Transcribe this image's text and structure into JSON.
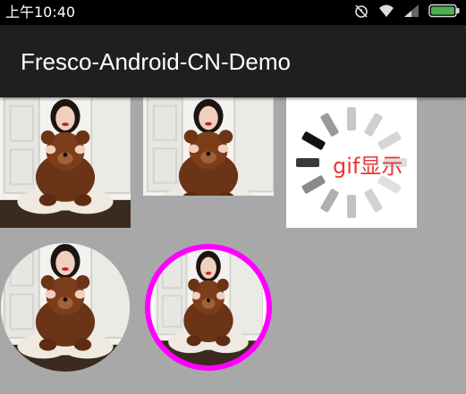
{
  "status_bar": {
    "time": "上午10:40",
    "icons": [
      "alarm-off-icon",
      "wifi-icon",
      "signal-icon",
      "battery-icon"
    ],
    "battery_color": "#4caf50"
  },
  "action_bar": {
    "title": "Fresco-Android-CN-Demo"
  },
  "images": [
    {
      "name": "photo-tile-1",
      "kind": "plain"
    },
    {
      "name": "photo-tile-2",
      "kind": "plain"
    },
    {
      "name": "gif-tile",
      "kind": "gif-loading",
      "label": "gif显示"
    },
    {
      "name": "photo-circle-1",
      "kind": "circle"
    },
    {
      "name": "photo-circle-bordered",
      "kind": "circle-border",
      "border_color": "#ff00ff"
    }
  ],
  "colors": {
    "background": "#a8a8a8",
    "action_bar": "#1f1f1f",
    "gif_label": "#e53935",
    "border_accent": "#ff00ff"
  }
}
